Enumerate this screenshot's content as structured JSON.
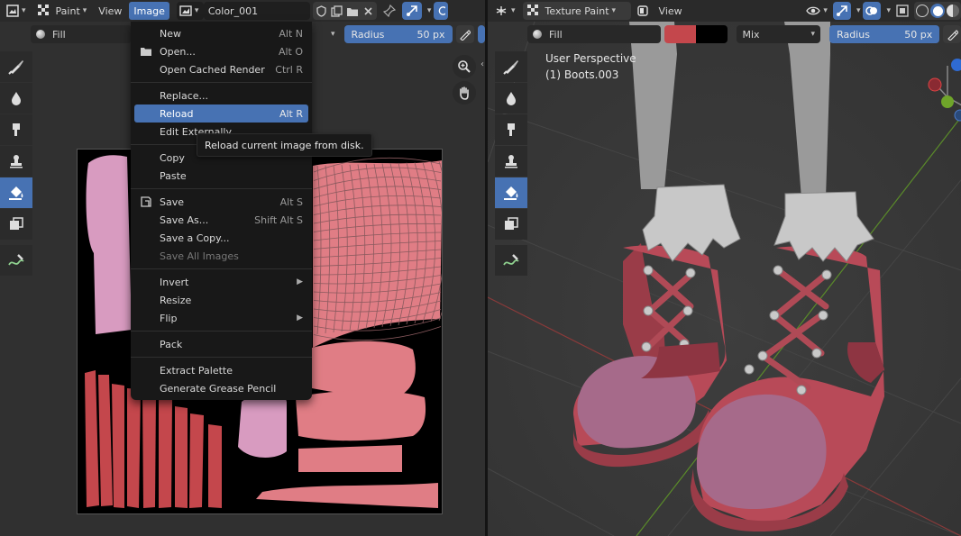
{
  "left_editor": {
    "header": {
      "editor_icon": "image-editor-icon",
      "mode": "Paint",
      "menus": [
        "View",
        "Image"
      ],
      "image_name": "Color_001"
    },
    "tool_settings": {
      "brush_name": "Fill",
      "radius_label": "Radius",
      "radius_value": "50 px"
    }
  },
  "image_menu": {
    "items": [
      {
        "label": "New",
        "shortcut": "Alt N"
      },
      {
        "label": "Open...",
        "shortcut": "Alt O"
      },
      {
        "label": "Open Cached Render",
        "shortcut": "Ctrl R"
      },
      {
        "label": "Replace...",
        "shortcut": ""
      },
      {
        "label": "Reload",
        "shortcut": "Alt R"
      },
      {
        "label": "Edit Externally",
        "shortcut": ""
      },
      {
        "label": "Copy",
        "shortcut": ""
      },
      {
        "label": "Paste",
        "shortcut": ""
      },
      {
        "label": "Save",
        "shortcut": "Alt S"
      },
      {
        "label": "Save As...",
        "shortcut": "Shift Alt S"
      },
      {
        "label": "Save a Copy...",
        "shortcut": ""
      },
      {
        "label": "Save All Images",
        "shortcut": ""
      },
      {
        "label": "Invert",
        "shortcut": ""
      },
      {
        "label": "Resize",
        "shortcut": ""
      },
      {
        "label": "Flip",
        "shortcut": ""
      },
      {
        "label": "Pack",
        "shortcut": ""
      },
      {
        "label": "Extract Palette",
        "shortcut": ""
      },
      {
        "label": "Generate Grease Pencil",
        "shortcut": ""
      }
    ],
    "tooltip": "Reload current image from disk."
  },
  "right_editor": {
    "header": {
      "mode": "Texture Paint",
      "menus": [
        "View"
      ]
    },
    "tool_settings": {
      "brush_name": "Fill",
      "blend_mode": "Mix",
      "radius_label": "Radius",
      "radius_value": "50 px",
      "color_primary": "#c4474c",
      "color_secondary": "#000000"
    },
    "viewport": {
      "perspective": "User Perspective",
      "object": "(1) Boots.003"
    }
  },
  "colors": {
    "accent": "#4772b3",
    "uv_pink": "#e07d85",
    "uv_lilac": "#d89bc0",
    "uv_red": "#c4474c",
    "boot_body": "#b84a58",
    "boot_toe": "#a66a8a"
  }
}
